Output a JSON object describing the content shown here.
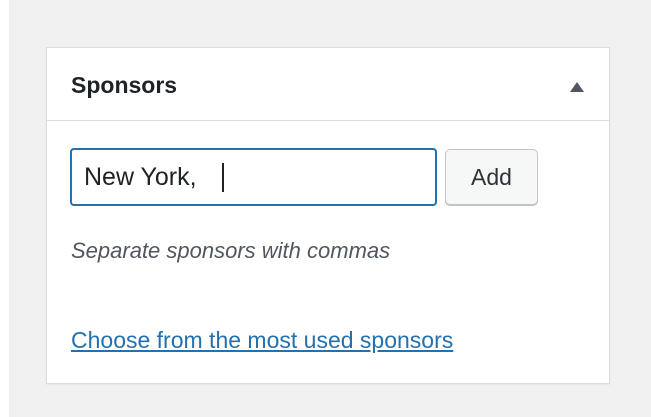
{
  "panel": {
    "title": "Sponsors",
    "toggle_icon": "triangle-up-icon"
  },
  "tag_input": {
    "value": "New York, "
  },
  "add_button": {
    "label": "Add"
  },
  "howto": {
    "text": "Separate sponsors with commas"
  },
  "most_used_link": {
    "text": "Choose from the most used sponsors"
  },
  "colors": {
    "background": "#f0f0f1",
    "panel_border": "#dcdcde",
    "focus_blue": "#2271b1",
    "link_blue": "#2271b1"
  }
}
